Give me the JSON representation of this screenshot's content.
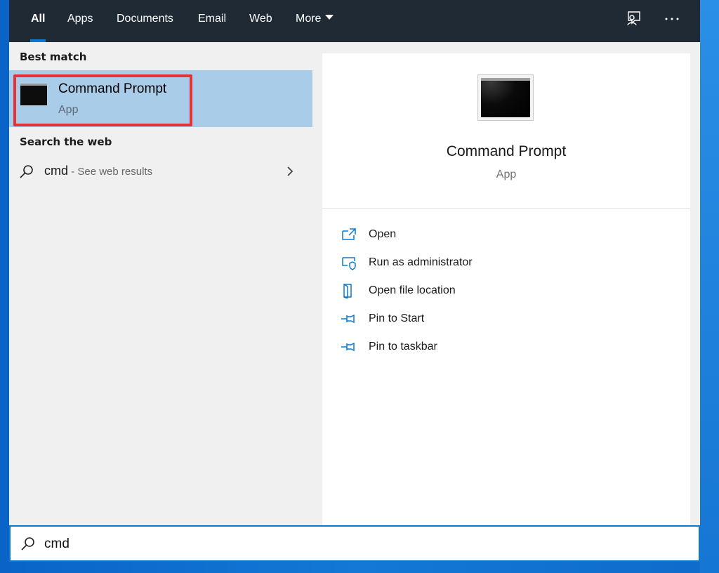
{
  "tabs": [
    {
      "label": "All",
      "active": true
    },
    {
      "label": "Apps"
    },
    {
      "label": "Documents"
    },
    {
      "label": "Email"
    },
    {
      "label": "Web"
    },
    {
      "label": "More"
    }
  ],
  "top_icons": [
    "feedback-icon",
    "more-options-icon"
  ],
  "left_pane": {
    "best_match_title": "Best match",
    "best_match": {
      "name": "Command Prompt",
      "type": "App",
      "icon": "command-prompt-icon"
    },
    "search_web_title": "Search the web",
    "web_result": {
      "query": "cmd",
      "suffix": " - See web results"
    }
  },
  "right_pane": {
    "title": "Command Prompt",
    "subtitle": "App",
    "actions": [
      {
        "label": "Open",
        "icon": "open-icon"
      },
      {
        "label": "Run as administrator",
        "icon": "admin-shield-icon"
      },
      {
        "label": "Open file location",
        "icon": "file-location-icon"
      },
      {
        "label": "Pin to Start",
        "icon": "pin-icon"
      },
      {
        "label": "Pin to taskbar",
        "icon": "pin-icon"
      }
    ]
  },
  "search": {
    "value": "cmd"
  },
  "colors": {
    "accent": "#0b78d4",
    "highlight": "#a9cce9",
    "topbar": "#1f2a35",
    "callout": "#e53238"
  }
}
